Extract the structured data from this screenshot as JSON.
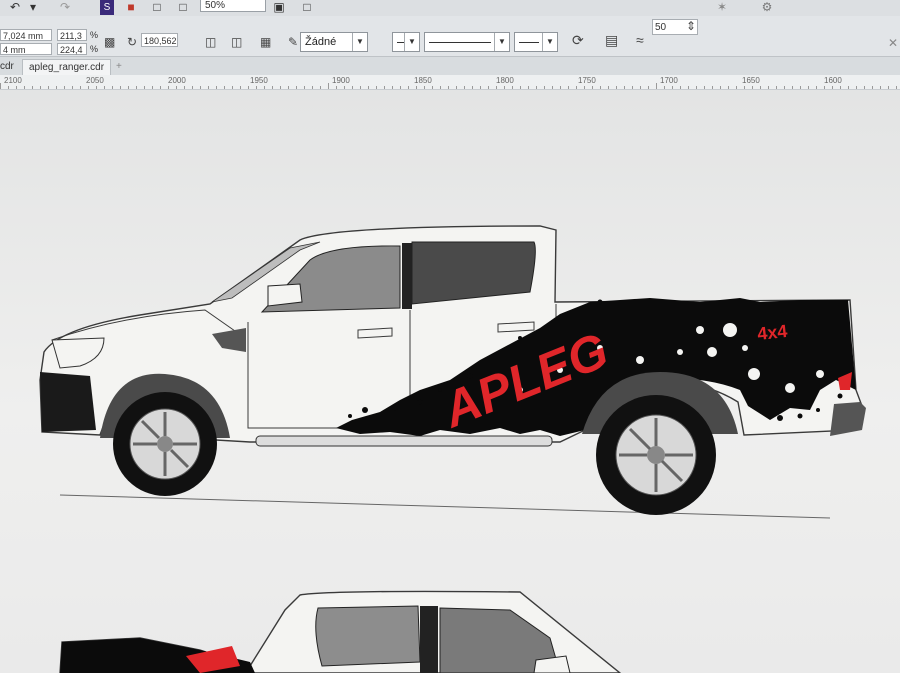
{
  "toolbar": {
    "undo_icon": "undo-icon",
    "redo_icon": "redo-icon",
    "app_icon": "app-launcher-icon",
    "zoom_value": "50%"
  },
  "property_bar": {
    "pos_x": "7,024 mm",
    "pos_y": "4 mm",
    "scale_w": "211,3",
    "scale_h": "224,4",
    "scale_unit": "%",
    "rotation": "180,562",
    "outline_style": "Žádné",
    "smooth_value": "50"
  },
  "tabs": {
    "partial": "cdr",
    "active": "apleg_ranger.cdr",
    "add": "+"
  },
  "ruler": {
    "ticks": [
      "2100",
      "2050",
      "2000",
      "1950",
      "1900",
      "1850",
      "1800",
      "1750",
      "1700",
      "1650",
      "1600"
    ]
  },
  "artwork": {
    "brand_text": "APLEG",
    "badge_text": "4x4",
    "colors": {
      "decal_black": "#0b0b0b",
      "decal_red": "#e0262a",
      "body": "#f4f4f2",
      "line": "#3a3a3a"
    }
  }
}
